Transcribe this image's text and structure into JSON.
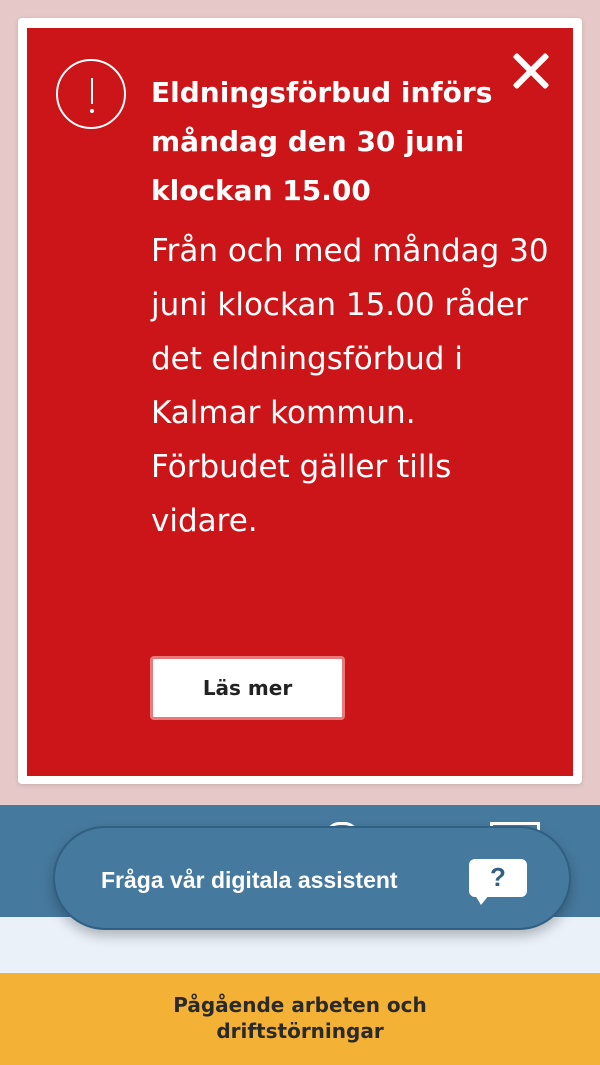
{
  "alert": {
    "title": "Eldningsförbud införs måndag den 30 juni klockan 15.00",
    "body": "Från och med måndag 30 juni klockan 15.00 råder det eldningsförbud i Kalmar kommun. Förbudet gäller tills vidare.",
    "read_more_label": "Läs mer",
    "close_icon": "close-icon",
    "alert_icon": "exclamation-circle-icon"
  },
  "assistant": {
    "label": "Fråga vår digitala assistent",
    "icon": "chat-question-icon",
    "icon_glyph": "?"
  },
  "works_banner": {
    "label": "Pågående arbeten och driftstörningar"
  },
  "colors": {
    "alert_red": "#cc1518",
    "header_blue": "#46799e",
    "banner_yellow": "#f3b135",
    "overlay_pink": "#e6c8c8"
  }
}
